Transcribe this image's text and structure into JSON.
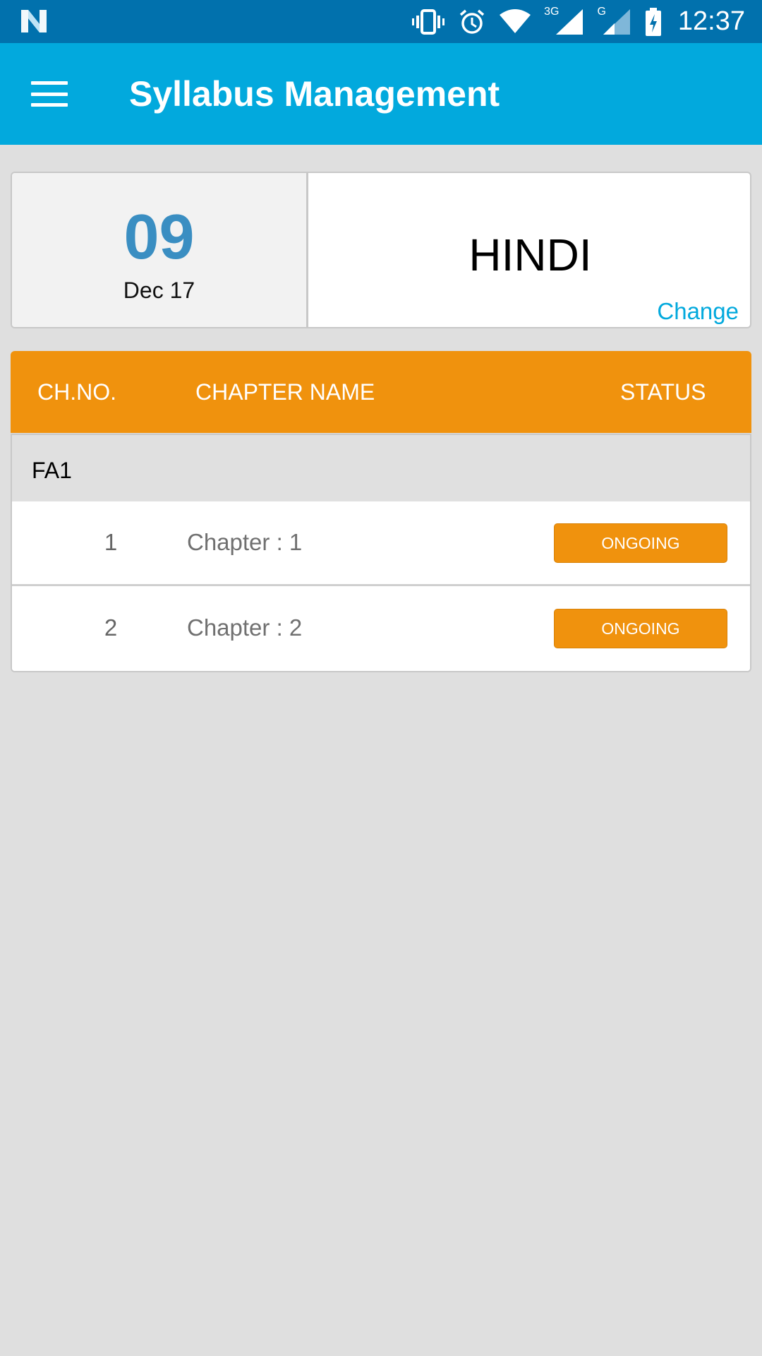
{
  "status_bar": {
    "time": "12:37",
    "network_3g": "3G",
    "network_g": "G",
    "icons": [
      "n-logo-icon",
      "vibrate-icon",
      "alarm-icon",
      "wifi-icon",
      "signal-3g-icon",
      "signal-g-icon",
      "battery-charging-icon"
    ]
  },
  "app_bar": {
    "title": "Syllabus Management",
    "menu_icon": "hamburger-menu-icon"
  },
  "info_card": {
    "day": "09",
    "month_year": "Dec 17",
    "subject": "HINDI",
    "change_label": "Change"
  },
  "table": {
    "headers": {
      "chapter_no": "CH.NO.",
      "chapter_name": "CHAPTER NAME",
      "status": "STATUS"
    },
    "section": "FA1",
    "rows": [
      {
        "number": "1",
        "name": "Chapter : 1",
        "status": "ONGOING"
      },
      {
        "number": "2",
        "name": "Chapter : 2",
        "status": "ONGOING"
      }
    ]
  },
  "colors": {
    "status_bar": "#0171ad",
    "app_bar": "#02a9dd",
    "accent_orange": "#f0920d",
    "date_blue": "#3a8ec2",
    "background": "#dfdfdf"
  }
}
